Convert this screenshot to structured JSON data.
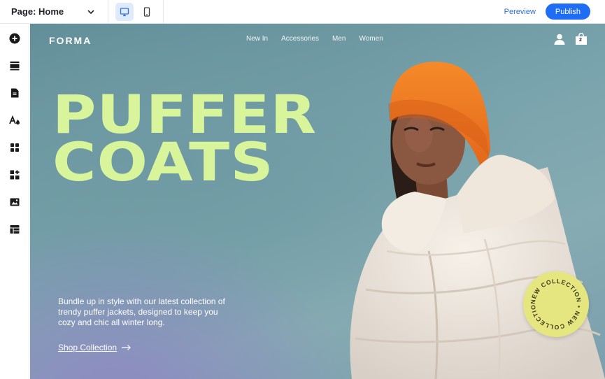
{
  "editor": {
    "page_selector": "Page: Home",
    "preview_label": "Pereview",
    "publish_label": "Publish",
    "devices": [
      "desktop-icon",
      "mobile-icon"
    ],
    "accent": "#1f6cf5",
    "sidebar_tools": [
      "add-icon",
      "sections-icon",
      "pages-icon",
      "theme-icon",
      "apps-icon",
      "plugins-icon",
      "media-icon",
      "cms-icon"
    ]
  },
  "site": {
    "logo": "FORMA",
    "nav": [
      "New In",
      "Accessories",
      "Men",
      "Women"
    ],
    "cart_count": "2",
    "hero": {
      "title_line1": "PUFFER",
      "title_line2": "COATS",
      "description": "Bundle up in style with our latest collection of trendy puffer jackets, designed to keep you cozy and chic all winter long.",
      "cta": "Shop Collection",
      "badge_text": "NEW COLLECTION • NEW COLLECTION •"
    },
    "colors": {
      "title": "#d9f59b",
      "badge": "#e6e681",
      "beanie": "#f07a1a",
      "coat": "#f1e9df"
    }
  }
}
